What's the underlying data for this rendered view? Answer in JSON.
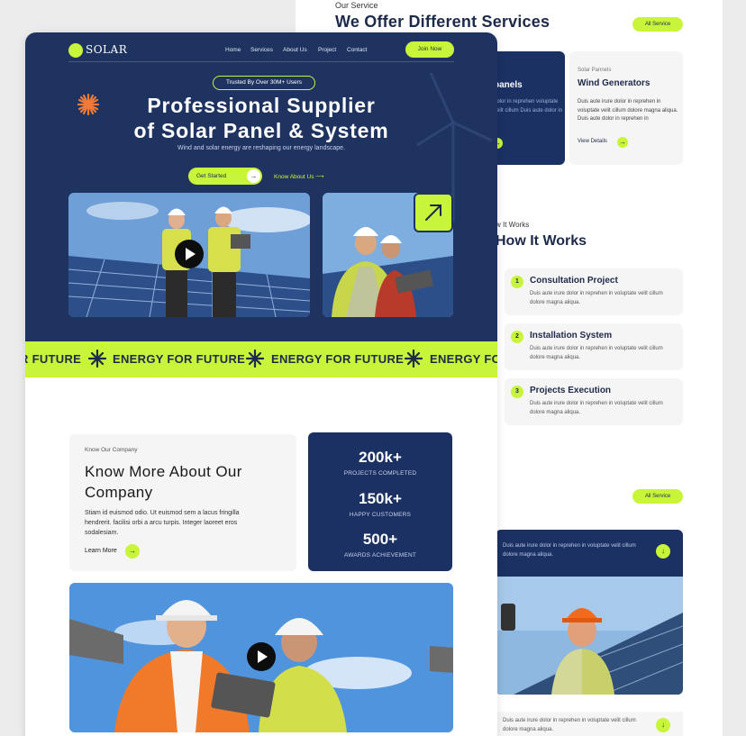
{
  "back": {
    "eyebrow": "Our Service",
    "title": "We Offer Different Services",
    "all_service_top": "All Service",
    "card_dark": {
      "title": "panels",
      "desc": "dolor in reprehen voluptate velit cillum Duis aute dolor in"
    },
    "card_light": {
      "eyebrow": "Solar Pannels",
      "title": "Wind Generators",
      "desc": "Duis aute irure dolor in reprehen in voluptate velit cillum dolore magna aliqua. Duis aute dolor in reprehen in",
      "link": "View Details"
    },
    "hiw_eyebrow": "w It Works",
    "hiw_title": "How It Works",
    "steps": [
      {
        "num": "1",
        "title": "Consultation Project",
        "desc": "Duis aute irure dolor in reprehen in voluptate velit cillum dolore magna aliqua."
      },
      {
        "num": "2",
        "title": "Installation System",
        "desc": "Duis aute irure dolor in reprehen in voluptate velit cillum dolore magna aliqua."
      },
      {
        "num": "3",
        "title": "Projects Execution",
        "desc": "Duis aute irure dolor in reprehen in voluptate velit cillum dolore magna aliqua."
      }
    ],
    "all_service_bottom": "All Service",
    "blue_desc": "Duis aute irure dolor in reprehen in voluptate velit cillum dolore magna aliqua.",
    "bottom_desc": "Duis aute irure dolor in reprehen in voluptate velit cillum dolore magna aliqua."
  },
  "front": {
    "logo": "SOLAR",
    "nav": [
      "Home",
      "Services",
      "About Us",
      "Project",
      "Contact"
    ],
    "join": "Join Now",
    "trusted": "Trusted By Over 30M+ Users",
    "title_line1": "Professional Supplier",
    "title_line2": "of Solar Panel & System",
    "subtitle": "Wind and solar energy are reshaping our energy landscape.",
    "get_started": "Get Started",
    "know_about": "Know About Us",
    "marquee": [
      "R FUTURE",
      "ENERGY FOR FUTURE",
      "ENERGY FOR FUTURE",
      "ENERGY FO"
    ],
    "about": {
      "eyebrow": "Know Our Company",
      "title": "Know More About Our Company",
      "desc": "Stiam id euismod odio. Ut euismod sem a lacus fringilla hendrerit. facilisi orbi a arcu turpis. Integer laoreet eros sodalesiam.",
      "link": "Learn More"
    },
    "stats": [
      {
        "value": "200k+",
        "label": "PROJECTS COMPLETED"
      },
      {
        "value": "150k+",
        "label": "HAPPY CUSTOMERS"
      },
      {
        "value": "500+",
        "label": "AWARDS ACHIEVEMENT"
      }
    ]
  },
  "colors": {
    "navy": "#1e3360",
    "lime": "#c8f53a",
    "card_navy": "#1b3164"
  },
  "icons": [
    "play-icon",
    "arrow-up-right-icon",
    "arrow-right-icon",
    "sun-burst-icon",
    "star-icon",
    "arrow-down-icon"
  ]
}
